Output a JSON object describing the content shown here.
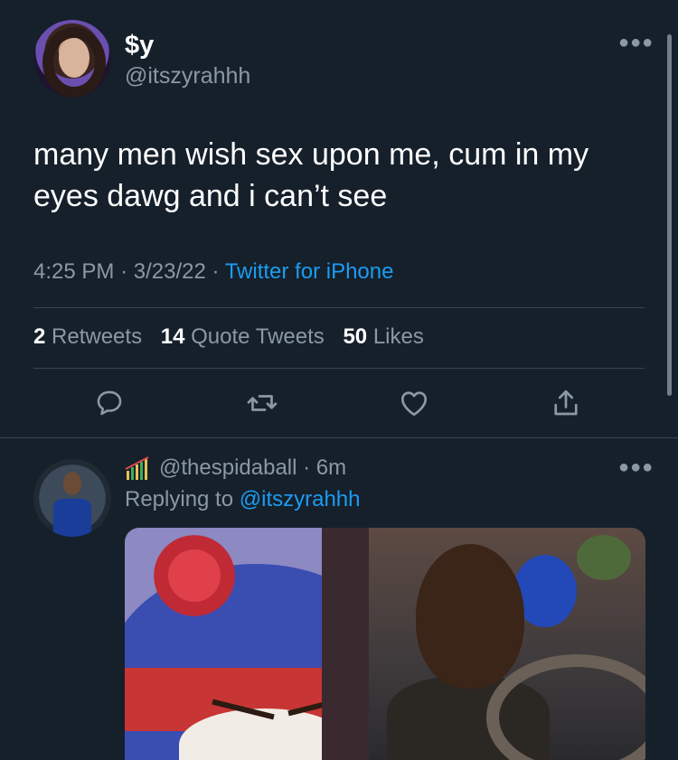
{
  "main_tweet": {
    "display_name": "$y",
    "handle": "@itszyrahhh",
    "text": "many men wish sex upon me, cum in my eyes dawg and i can’t see",
    "time": "4:25 PM",
    "date": "3/23/22",
    "source": "Twitter for iPhone",
    "stats": {
      "retweets_count": "2",
      "retweets_label": "Retweets",
      "quotes_count": "14",
      "quotes_label": "Quote Tweets",
      "likes_count": "50",
      "likes_label": "Likes"
    },
    "actions": [
      "reply-icon",
      "retweet-icon",
      "like-icon",
      "share-icon"
    ]
  },
  "reply": {
    "handle": "@thespidaball",
    "time_ago": "6m",
    "replying_prefix": "Replying to",
    "replying_to": "@itszyrahhh"
  },
  "colors": {
    "background": "#15202b",
    "secondary_text": "#8b98a5",
    "link": "#1d9bf0",
    "divider": "#38444d"
  }
}
